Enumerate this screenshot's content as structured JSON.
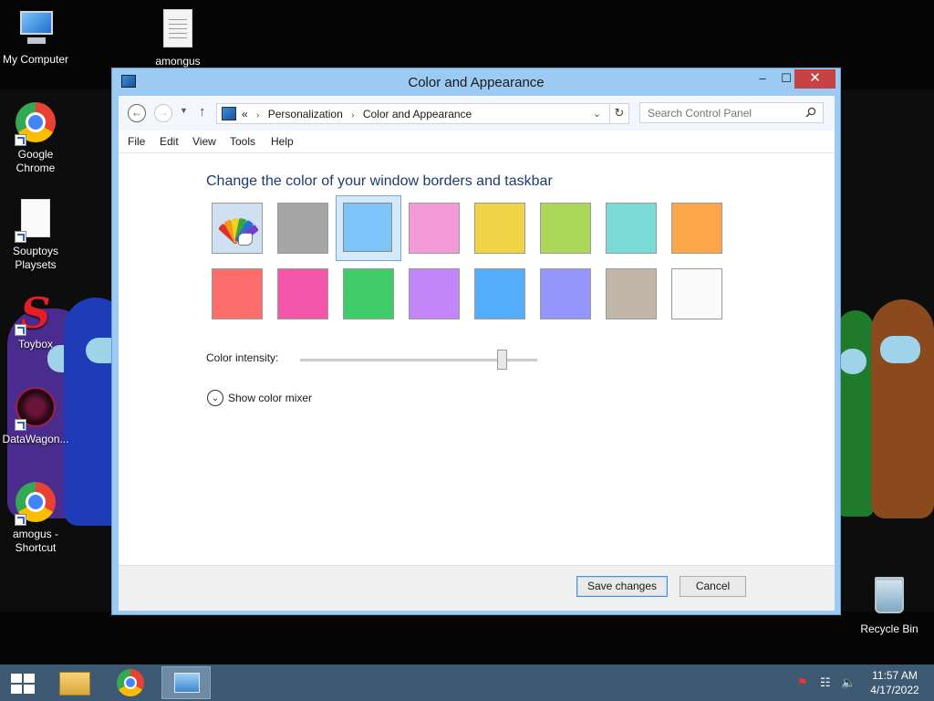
{
  "desktop": {
    "icons": [
      {
        "label": "My Computer"
      },
      {
        "label": "amongus"
      },
      {
        "label": "Google Chrome"
      },
      {
        "label": "Souptoys Playsets"
      },
      {
        "label": "Toybox"
      },
      {
        "label": "DataWagon..."
      },
      {
        "label": "amogus - Shortcut"
      },
      {
        "label": "Recycle Bin"
      }
    ],
    "toybox_glyph": "S"
  },
  "window": {
    "title": "Color and Appearance",
    "controls": {
      "minimize": "–",
      "maximize": "☐",
      "close": "✕"
    }
  },
  "address": {
    "back_glyph": "←",
    "forward_glyph": "→",
    "recent_glyph": "▼",
    "up_glyph": "↑",
    "overflow": "«",
    "breadcrumbs": [
      "Personalization",
      "Color and Appearance"
    ],
    "crumb_sep": "›",
    "dropdown_glyph": "⌄",
    "refresh_glyph": "↻"
  },
  "search": {
    "placeholder": "Search Control Panel",
    "value": "",
    "icon": "search-icon"
  },
  "menu": [
    "File",
    "Edit",
    "View",
    "Tools",
    "Help"
  ],
  "content": {
    "heading": "Change the color of your window borders and taskbar",
    "swatches_row1": [
      "custom",
      "#a6a6a6",
      "#7dc4f8",
      "#f49ad6",
      "#f0d445",
      "#acd85a",
      "#7adad6",
      "#fba649"
    ],
    "swatches_row2": [
      "#fc6d6c",
      "#f356a8",
      "#41cc6a",
      "#c286f9",
      "#53adfa",
      "#9596fc",
      "#c2b6a9",
      "#fafafa"
    ],
    "selected_swatch": "#7dc4f8",
    "intensity_label": "Color intensity:",
    "intensity_value": 0.85,
    "mixer_label": "Show color mixer",
    "mixer_glyph": "⌄"
  },
  "footer": {
    "save_label": "Save changes",
    "cancel_label": "Cancel"
  },
  "taskbar": {
    "apps": [
      "file-explorer",
      "google-chrome",
      "control-panel"
    ],
    "active_app": "control-panel",
    "time": "11:57 AM",
    "date": "4/17/2022",
    "tray_flag_glyph": "⚑",
    "tray_network_glyph": "☷",
    "tray_volume_glyph": "🔈"
  },
  "colors": {
    "titlebar": "#9ccaf2",
    "taskbar": "#3e5a73",
    "heading": "#1e3b6e",
    "close": "#c74343"
  }
}
